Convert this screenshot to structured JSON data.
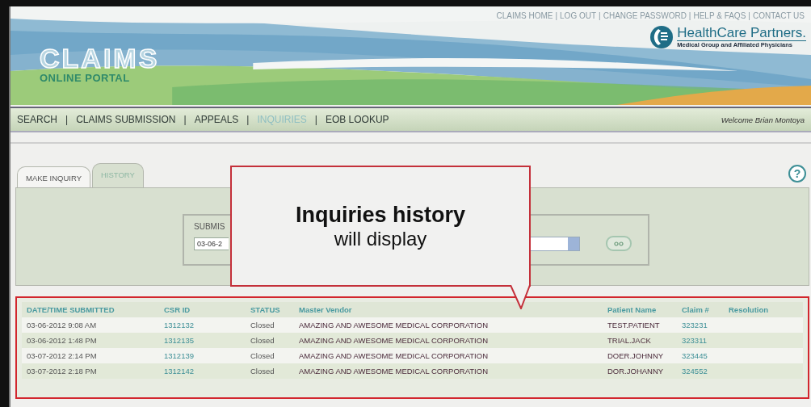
{
  "top_links": [
    {
      "label": "CLAIMS HOME"
    },
    {
      "label": "LOG OUT",
      "separator": "|"
    },
    {
      "label": "CHANGE PASSWORD",
      "separator": "|"
    },
    {
      "label": "HELP & FAQS",
      "separator": "|"
    },
    {
      "label": "CONTACT US",
      "separator": "|"
    }
  ],
  "portal_logo": {
    "title": "CLAIMS",
    "subtitle": "ONLINE PORTAL"
  },
  "partner_logo": {
    "name": "HealthCare Partners.",
    "tagline": "Medical Group and Affiliated Physicians"
  },
  "nav": [
    {
      "label": "SEARCH",
      "selected": false
    },
    {
      "label": "CLAIMS SUBMISSION",
      "separator": "|",
      "selected": false
    },
    {
      "label": "APPEALS",
      "separator": "|",
      "selected": false
    },
    {
      "label": "INQUIRIES",
      "separator": "|",
      "selected": true
    },
    {
      "label": "EOB LOOKUP",
      "separator": "|",
      "selected": false
    }
  ],
  "welcome": "Welcome Brian Montoya",
  "help": "?",
  "tabs": [
    {
      "label": "MAKE INQUIRY",
      "selected": false
    },
    {
      "label": "HISTORY",
      "selected": true
    }
  ],
  "filter": {
    "label": "SUBMIS",
    "date_value": "03-06-2"
  },
  "callout": {
    "title": "Inquiries history",
    "body": "will display"
  },
  "table": {
    "columns": [
      "DATE/TIME SUBMITTED",
      "CSR ID",
      "STATUS",
      "Master Vendor",
      "Patient Name",
      "Claim #",
      "Resolution"
    ],
    "rows": [
      {
        "date": "03-06-2012 9:08 AM",
        "csr_id": "1312132",
        "status": "Closed",
        "vendor": "AMAZING AND AWESOME MEDICAL CORPORATION",
        "patient": "TEST.PATIENT",
        "claim": "323231"
      },
      {
        "date": "03-06-2012 1:48 PM",
        "csr_id": "1312135",
        "status": "Closed",
        "vendor": "AMAZING AND AWESOME MEDICAL CORPORATION",
        "patient": "TRIAL.JACK",
        "claim": "323311"
      },
      {
        "date": "03-07-2012 2:14 PM",
        "csr_id": "1312139",
        "status": "Closed",
        "vendor": "AMAZING AND AWESOME MEDICAL CORPORATION",
        "patient": "DOER.JOHNNY",
        "claim": "323445"
      },
      {
        "date": "03-07-2012 2:18 PM",
        "csr_id": "1312142",
        "status": "Closed",
        "vendor": "AMAZING AND AWESOME MEDICAL CORPORATION",
        "patient": "DOR.JOHANNY",
        "claim": "324552"
      }
    ]
  }
}
